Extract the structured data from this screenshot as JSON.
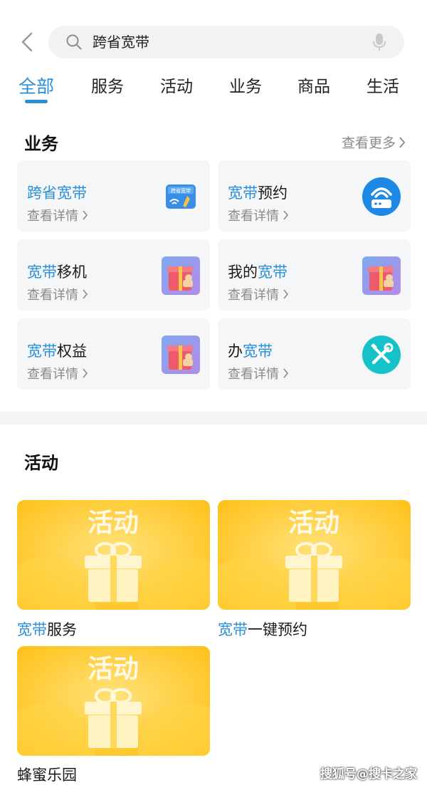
{
  "search": {
    "query": "跨省宽带"
  },
  "tabs": [
    "全部",
    "服务",
    "活动",
    "业务",
    "商品",
    "生活"
  ],
  "business": {
    "title": "业务",
    "more": "查看更多",
    "detail": "查看详情",
    "items": [
      {
        "pre": "",
        "hl": "跨省宽带",
        "post": "",
        "icon": "cross-province-broadband-icon",
        "icon_text": "跨省宽带"
      },
      {
        "pre": "",
        "hl": "宽带",
        "post": "预约",
        "icon": "router-icon"
      },
      {
        "pre": "",
        "hl": "宽带",
        "post": "移机",
        "icon": "gift-box-icon"
      },
      {
        "pre": "我的",
        "hl": "宽带",
        "post": "",
        "icon": "gift-box-icon"
      },
      {
        "pre": "",
        "hl": "宽带",
        "post": "权益",
        "icon": "gift-box-icon"
      },
      {
        "pre": "办",
        "hl": "宽带",
        "post": "",
        "icon": "tools-icon"
      }
    ]
  },
  "activities": {
    "title": "活动",
    "banner_text": "活动",
    "items": [
      {
        "hl": "宽带",
        "post": "服务"
      },
      {
        "hl": "宽带",
        "post": "一键预约"
      },
      {
        "hl": "",
        "post": "蜂蜜乐园"
      }
    ]
  },
  "watermark": "搜狐号@搜卡之家",
  "colors": {
    "accent": "#2a8fd6",
    "router_bg": "#1e88e5",
    "tools_bg": "#16c2c9",
    "activity_bg": "#ffc21a"
  }
}
